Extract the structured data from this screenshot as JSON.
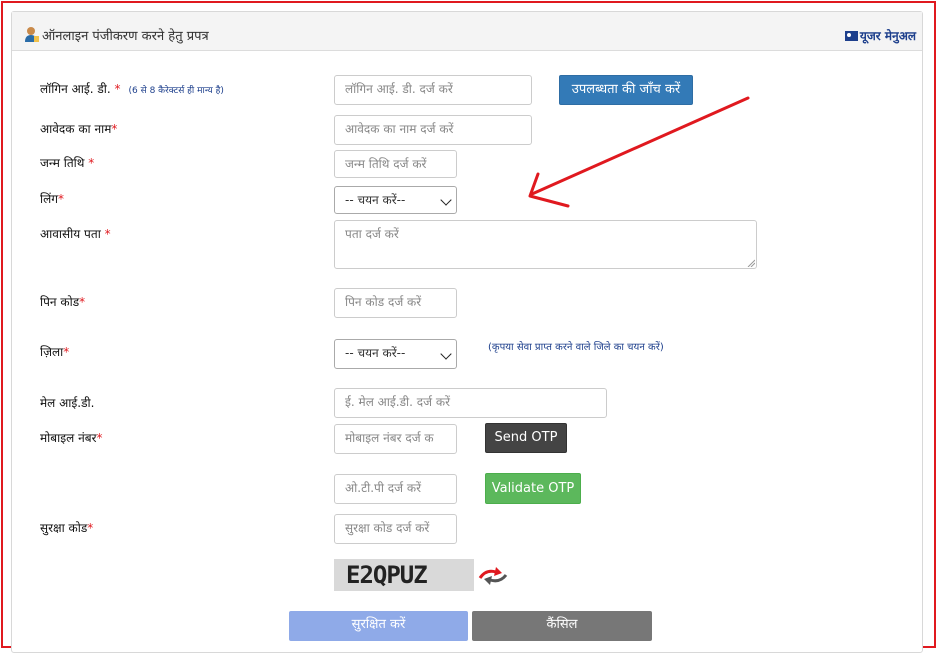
{
  "header": {
    "title": "ऑनलाइन पंजीकरण करने हेतु प्रपत्र",
    "manual_label": "यूजर मेनुअल"
  },
  "form": {
    "login": {
      "label": "लॉगिन आई. डी.",
      "required": "*",
      "note": "(6 से 8 कैरेक्टर्स ही मान्य है)",
      "placeholder": "लॉगिन आई. डी. दर्ज करें",
      "check_button": "उपलब्धता की जाँच करें"
    },
    "applicant_name": {
      "label": "आवेदक का नाम",
      "required": "*",
      "placeholder": "आवेदक का नाम दर्ज करें"
    },
    "dob": {
      "label": "जन्म तिथि",
      "required": "*",
      "placeholder": "जन्म तिथि दर्ज करें"
    },
    "gender": {
      "label": "लिंग",
      "required": "*",
      "selected": "-- चयन करें--"
    },
    "address": {
      "label": "आवासीय पता",
      "required": "*",
      "placeholder": "पता दर्ज करें"
    },
    "pincode": {
      "label": "पिन कोड",
      "required": "*",
      "placeholder": "पिन कोड दर्ज करें"
    },
    "district": {
      "label": "ज़िला",
      "required": "*",
      "selected": "-- चयन करें--",
      "hint": "(कृपया सेवा प्राप्त करने वाले जिले का चयन करें)"
    },
    "email": {
      "label": "मेल आई.डी.",
      "placeholder": "ई. मेल आई.डी. दर्ज करें"
    },
    "mobile": {
      "label": "मोबाइल नंबर",
      "required": "*",
      "placeholder": "मोबाइल नंबर दर्ज क",
      "send_otp": "Send OTP"
    },
    "otp": {
      "placeholder": "ओ.टी.पी दर्ज करें",
      "validate_otp": "Validate OTP"
    },
    "security_code": {
      "label": "सुरक्षा कोड",
      "required": "*",
      "placeholder": "सुरक्षा कोड दर्ज करें",
      "captcha_text": "E2QPUZ"
    }
  },
  "actions": {
    "save": "सुरक्षित करें",
    "cancel": "कैंसिल"
  },
  "colors": {
    "annotation": "#e0191f",
    "primary": "#337ab7",
    "dark": "#444444",
    "success": "#5cb85c",
    "save_disabled": "#8faae8",
    "cancel": "#777777"
  }
}
